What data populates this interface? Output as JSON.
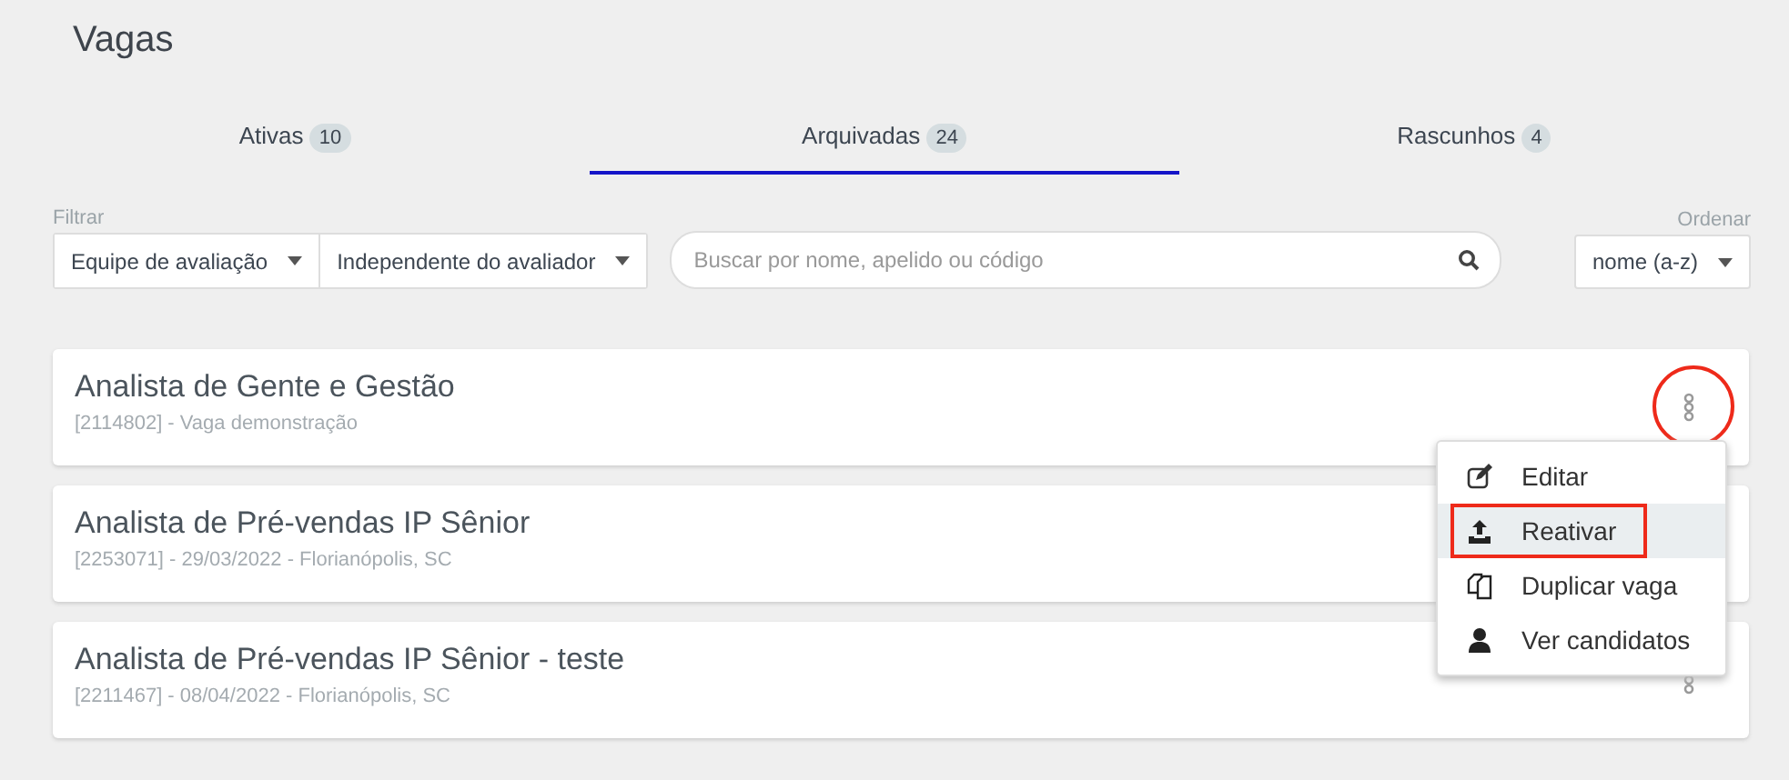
{
  "title": "Vagas",
  "tabs": [
    {
      "label": "Ativas",
      "count": "10",
      "selected": false
    },
    {
      "label": "Arquivadas",
      "count": "24",
      "selected": true
    },
    {
      "label": "Rascunhos",
      "count": "4",
      "selected": false
    }
  ],
  "filters": {
    "label": "Filtrar",
    "dropdowns": [
      "Equipe de avaliação",
      "Independente do avaliador"
    ],
    "search": {
      "placeholder": "Buscar por nome, apelido ou código"
    }
  },
  "sort": {
    "label": "Ordenar",
    "value": "nome (a-z)"
  },
  "jobs": [
    {
      "title": "Analista de Gente e Gestão",
      "details": "[2114802] - Vaga demonstração",
      "menu_open": true
    },
    {
      "title": "Analista de Pré-vendas IP Sênior",
      "details": "[2253071] - 29/03/2022 - Florianópolis, SC",
      "menu_open": false
    },
    {
      "title": "Analista de Pré-vendas IP Sênior - teste",
      "details": "[2211467] - 08/04/2022 - Florianópolis, SC",
      "menu_open": false
    }
  ],
  "menu": [
    {
      "kind": "edit",
      "label": "Editar",
      "selected": false
    },
    {
      "kind": "upload",
      "label": "Reativar",
      "selected": true
    },
    {
      "kind": "copy",
      "label": "Duplicar vaga",
      "selected": false
    },
    {
      "kind": "person",
      "label": "Ver candidatos",
      "selected": false
    }
  ]
}
